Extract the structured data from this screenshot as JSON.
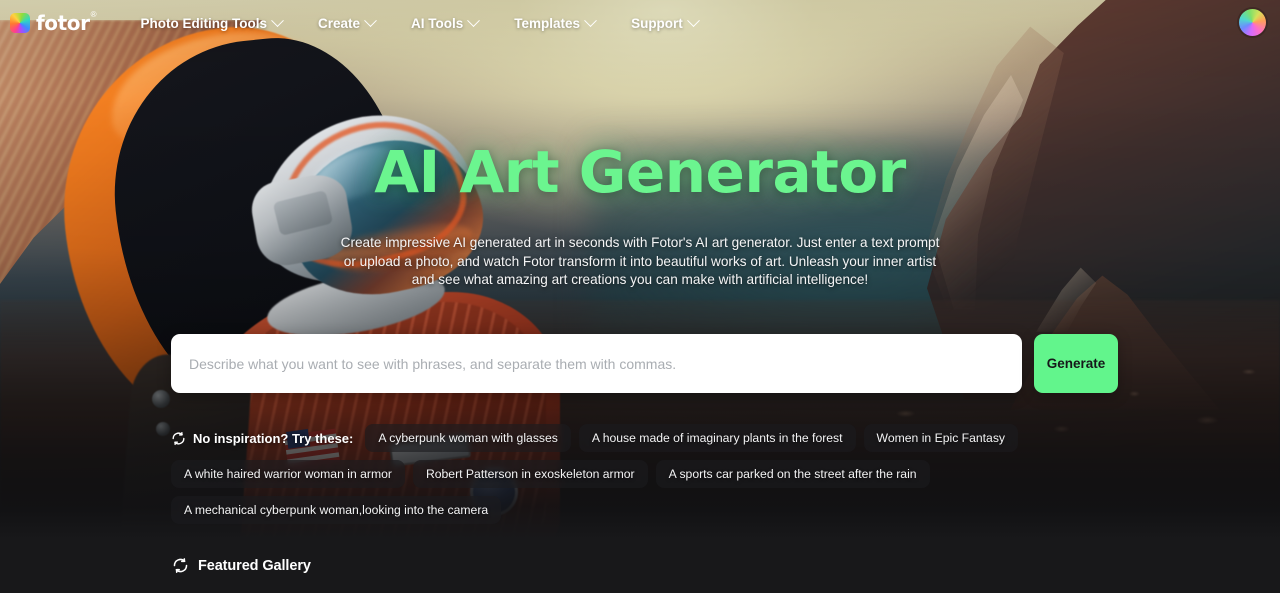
{
  "header": {
    "logo": {
      "name": "fotor",
      "trademark": "®"
    },
    "nav": [
      {
        "label": "Photo Editing Tools",
        "icon": "chevron-down-icon"
      },
      {
        "label": "Create",
        "icon": "chevron-down-icon"
      },
      {
        "label": "AI Tools",
        "icon": "chevron-down-icon"
      },
      {
        "label": "Templates",
        "icon": "chevron-down-icon"
      },
      {
        "label": "Support",
        "icon": "chevron-down-icon"
      }
    ],
    "avatar": {
      "icon": "user-avatar-icon"
    }
  },
  "hero": {
    "title": "AI Art Generator",
    "description": "Create impressive AI generated art in seconds with Fotor's AI art generator. Just enter a text prompt or upload a photo, and watch Fotor transform it into beautiful works of art. Unleash your inner artist and see what amazing art creations you can make with artificial intelligence!",
    "prompt": {
      "value": "",
      "placeholder": "Describe what you want to see with phrases, and separate them with commas.",
      "generate_label": "Generate"
    }
  },
  "suggestions": {
    "label": "No inspiration? Try these:",
    "refresh_icon": "refresh-icon",
    "rows": [
      [
        "A cyberpunk woman with glasses",
        "A house made of imaginary plants in the forest",
        "Women in Epic Fantasy"
      ],
      [
        "A white haired warrior woman in armor",
        "Robert Patterson in exoskeleton armor",
        "A sports car parked on the street after the rain"
      ],
      [
        "A mechanical cyberpunk woman,looking into the camera"
      ]
    ]
  },
  "featured": {
    "title": "Featured Gallery",
    "refresh_icon": "refresh-icon"
  },
  "colors": {
    "accent_green": "#62f58c",
    "title_green": "#6bf58f",
    "page_dark": "#18181a",
    "chip_bg": "rgba(28,28,30,0.62)"
  }
}
